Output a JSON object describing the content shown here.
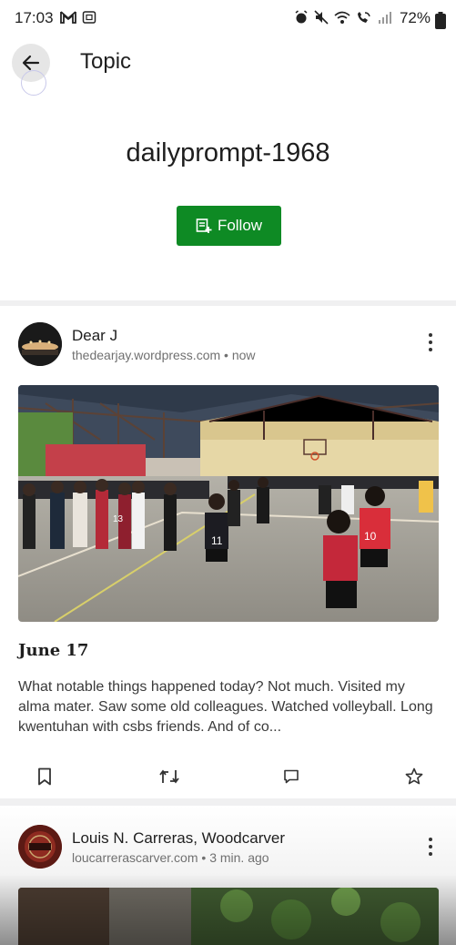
{
  "status_bar": {
    "time": "17:03",
    "battery": "72%",
    "left_icons": [
      "gmail-icon",
      "screenshot-icon"
    ],
    "right_icons": [
      "alarm-icon",
      "mute-icon",
      "wifi-icon",
      "wifi-call-icon",
      "signal-icon"
    ]
  },
  "header": {
    "title": "Topic",
    "back_icon": "arrow-left-icon"
  },
  "topic": {
    "name": "dailyprompt-1968",
    "follow_label": "Follow",
    "follow_icon": "reader-follow-icon",
    "accent_color": "#0e8a24"
  },
  "posts": [
    {
      "author": "Dear J",
      "site": "thedearjay.wordpress.com",
      "separator": "•",
      "time": "now",
      "title": "June 17",
      "excerpt": "What notable things happened today? Not much. Visited my alma mater. Saw some old colleagues. Watched volleyball. Long kwentuhan with csbs friends. And of co...",
      "image": "volleyball-gym-photo",
      "actions": [
        "bookmark-icon",
        "reblog-icon",
        "comment-icon",
        "star-icon"
      ]
    },
    {
      "author": "Louis N. Carreras, Woodcarver",
      "site": "loucarrerascarver.com",
      "separator": "•",
      "time": "3 min. ago",
      "image": "garden-photo"
    }
  ]
}
